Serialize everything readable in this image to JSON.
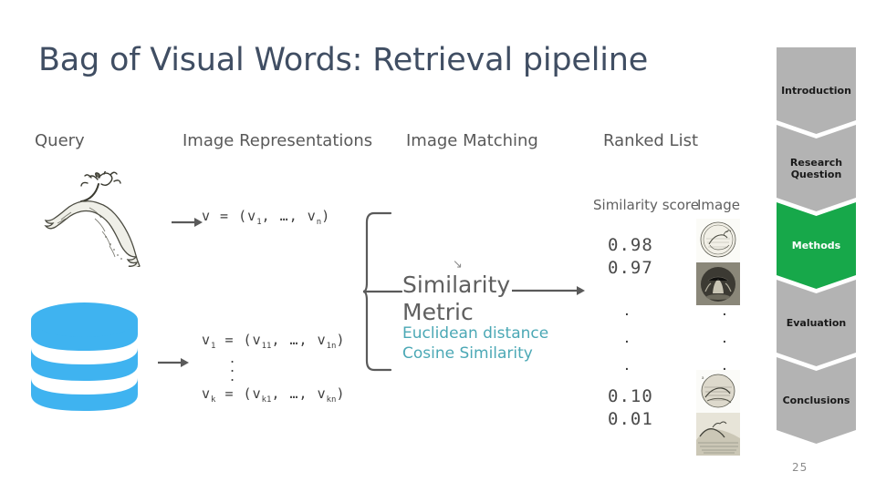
{
  "slide": {
    "title": "Bag of Visual Words: Retrieval pipeline",
    "page_number": "25"
  },
  "colors": {
    "title": "#404e63",
    "accent_teal": "#4ba8b5",
    "database_blue": "#3fb3f0",
    "nav_active_green": "#17a84a",
    "nav_inactive_gray": "#b3b3b3"
  },
  "pipeline": {
    "columns": [
      {
        "label": "Query"
      },
      {
        "label": "Image Representations"
      },
      {
        "label": "Image Matching"
      },
      {
        "label": "Ranked List"
      }
    ],
    "query": {
      "image_alt": "engraving of a leaping stag"
    },
    "database": {
      "icon": "database-cylinder-icon"
    },
    "representations": {
      "query_vector": "v = (v1, ..., vn)",
      "db_vector_first": "v1 = (v11, ..., v1n)",
      "db_vector_last": "vk = (vk1, ..., vkn)",
      "vertical_ellipsis": "⋮"
    },
    "matching": {
      "title_line1": "Similarity",
      "title_line2": "Metric",
      "options": [
        "Euclidean distance",
        "Cosine Similarity"
      ]
    },
    "ranked_list": {
      "headers": {
        "score": "Similarity score",
        "image": "Image"
      },
      "top_rows": [
        {
          "score": "0.98",
          "image_alt": "circular engraving of a deer"
        },
        {
          "score": "0.97",
          "image_alt": "engraving of a figure"
        }
      ],
      "ellipsis": "•",
      "bottom_rows": [
        {
          "score": "0.10",
          "image_alt": "circular engraving of a scene"
        },
        {
          "score": "0.01",
          "image_alt": "engraving of a landscape"
        }
      ]
    }
  },
  "sidebar": {
    "items": [
      {
        "label": "Introduction",
        "active": false
      },
      {
        "label": "Research Question",
        "active": false
      },
      {
        "label": "Methods",
        "active": true
      },
      {
        "label": "Evaluation",
        "active": false
      },
      {
        "label": "Conclusions",
        "active": false
      }
    ]
  }
}
